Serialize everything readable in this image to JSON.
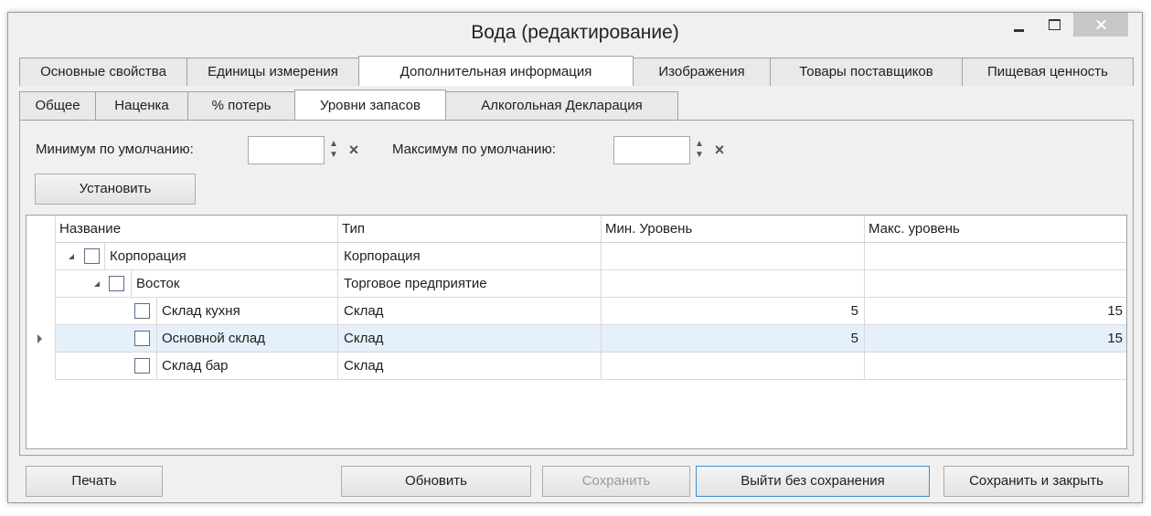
{
  "window": {
    "title": "Вода (редактирование)"
  },
  "tabs_main": [
    {
      "label": "Основные свойства",
      "active": false
    },
    {
      "label": "Единицы измерения",
      "active": false
    },
    {
      "label": "Дополнительная информация",
      "active": true
    },
    {
      "label": "Изображения",
      "active": false
    },
    {
      "label": "Товары поставщиков",
      "active": false
    },
    {
      "label": "Пищевая ценность",
      "active": false
    }
  ],
  "tabs_sub": [
    {
      "label": "Общее",
      "active": false
    },
    {
      "label": "Наценка",
      "active": false
    },
    {
      "label": "% потерь",
      "active": false
    },
    {
      "label": "Уровни запасов",
      "active": true
    },
    {
      "label": "Алкогольная Декларация",
      "active": false
    }
  ],
  "defaults": {
    "min_label": "Минимум по умолчанию:",
    "min_value": "",
    "max_label": "Максимум по умолчанию:",
    "max_value": "",
    "set_button": "Установить"
  },
  "grid": {
    "columns": [
      "Название",
      "Тип",
      "Мин. Уровень",
      "Макс. уровень"
    ],
    "rows": [
      {
        "name": "Корпорация",
        "type": "Корпорация",
        "min": "",
        "max": "",
        "expanded": true,
        "checked": false,
        "selected": false
      },
      {
        "name": "Восток",
        "type": "Торговое предприятие",
        "min": "",
        "max": "",
        "expanded": true,
        "checked": false,
        "selected": false
      },
      {
        "name": "Склад кухня",
        "type": "Склад",
        "min": "5",
        "max": "15",
        "checked": false,
        "selected": false
      },
      {
        "name": "Основной склад",
        "type": "Склад",
        "min": "5",
        "max": "15",
        "checked": false,
        "selected": true
      },
      {
        "name": "Склад бар",
        "type": "Склад",
        "min": "",
        "max": "",
        "checked": false,
        "selected": false
      }
    ]
  },
  "footer": {
    "print": "Печать",
    "refresh": "Обновить",
    "save": "Сохранить",
    "exit_without_save": "Выйти без сохранения",
    "save_and_close": "Сохранить и закрыть"
  }
}
